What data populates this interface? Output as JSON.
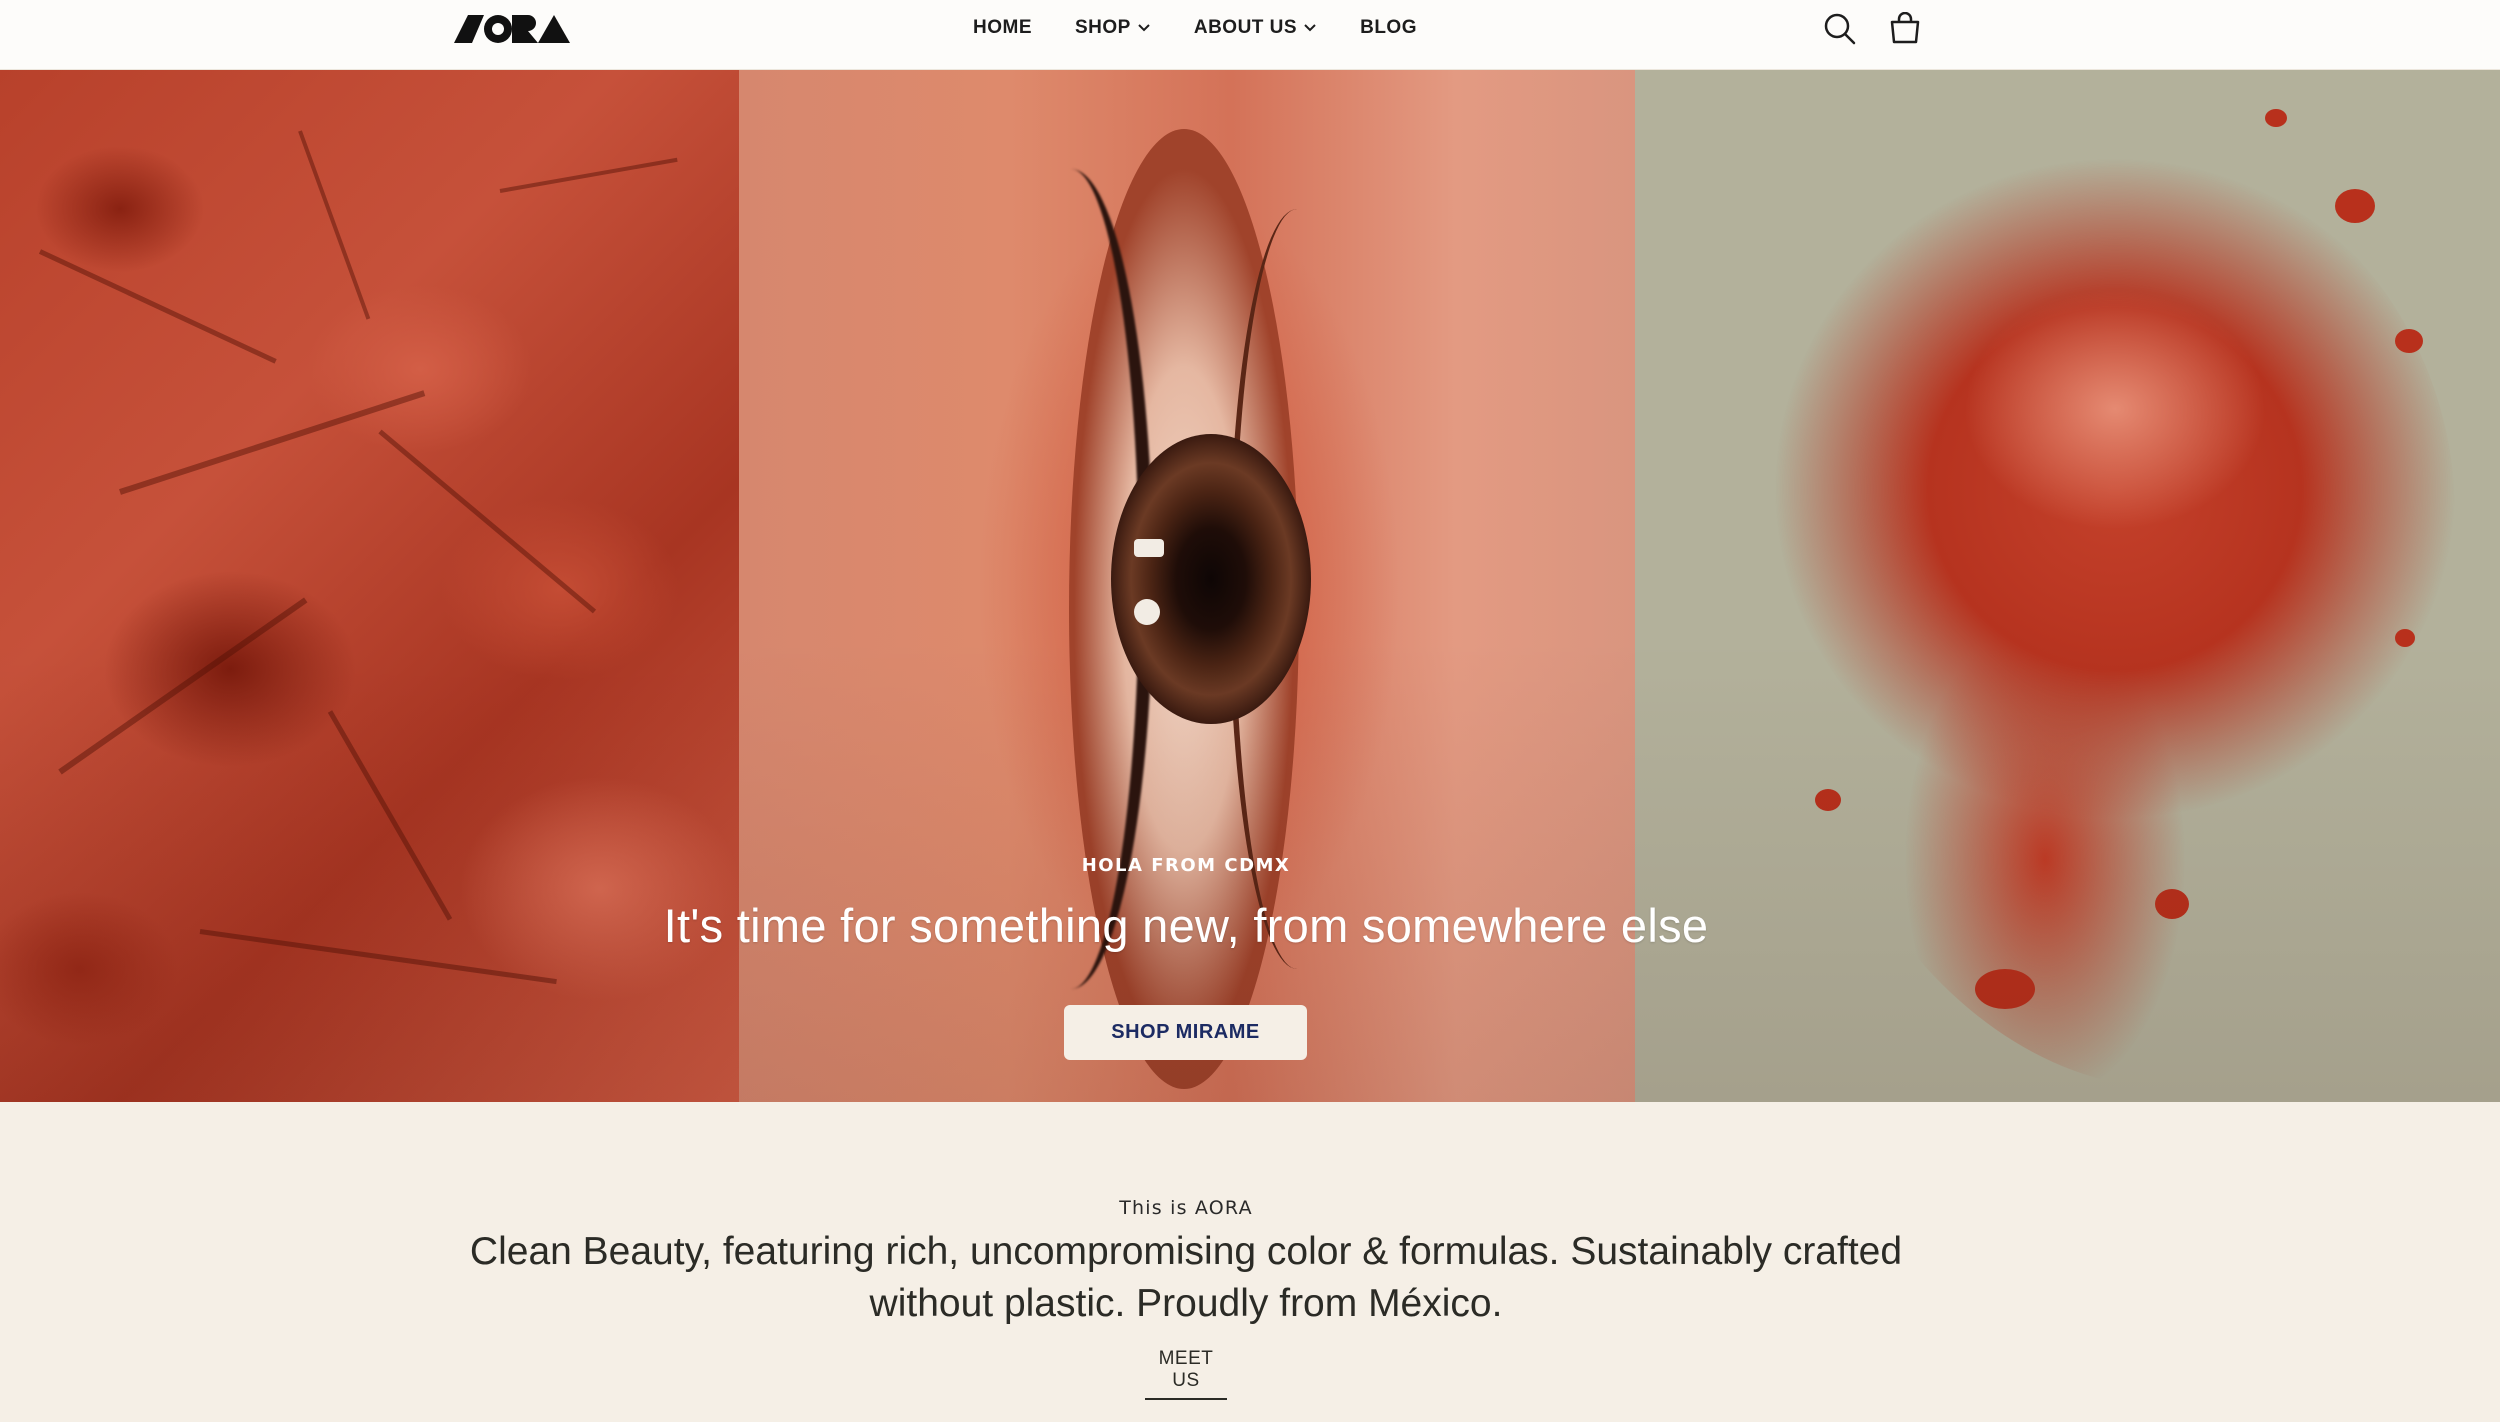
{
  "brand": {
    "logo_alt": "AORA"
  },
  "nav": {
    "items": [
      {
        "label": "HOME",
        "has_dropdown": false
      },
      {
        "label": "SHOP",
        "has_dropdown": true
      },
      {
        "label": "ABOUT US",
        "has_dropdown": true
      },
      {
        "label": "BLOG",
        "has_dropdown": false
      }
    ],
    "icons": [
      "search-icon",
      "shopping-bag-icon"
    ]
  },
  "hero": {
    "eyebrow": "HOLA FROM CDMX",
    "title": "It's time for something new, from somewhere else",
    "button_label": "SHOP MIRAME"
  },
  "intro": {
    "eyebrow": "This is AORA",
    "text": "Clean Beauty, featuring rich, uncompromising color & formulas. Sustainably crafted without plastic. Proudly from México.",
    "link_label": "MEET US"
  },
  "colors": {
    "header_bg": "#fdfcfa",
    "page_bg": "#f5efe6",
    "button_text": "#1c2b63",
    "hero_right_bg": "#b3b19b",
    "pigment_red": "#b6331f"
  }
}
